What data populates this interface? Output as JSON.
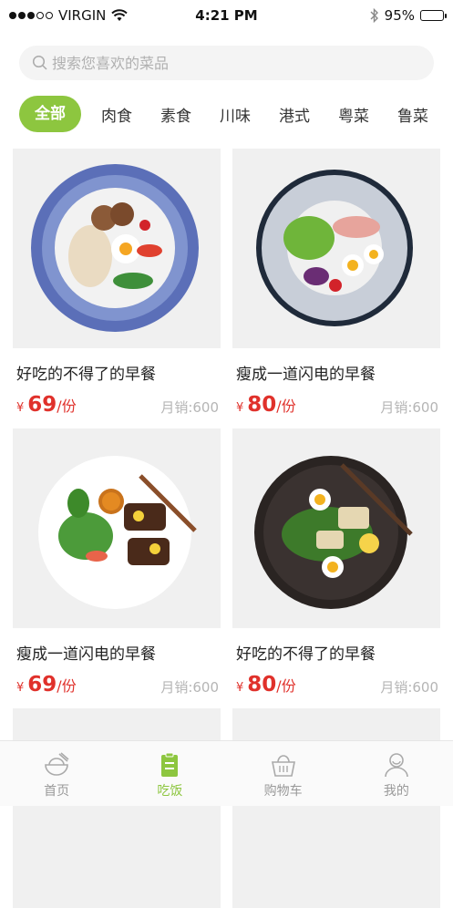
{
  "status_bar": {
    "carrier": "VIRGIN",
    "time": "4:21 PM",
    "battery": "95%",
    "battery_level": 0.95,
    "signal_bars": 3
  },
  "search": {
    "placeholder": "搜索您喜欢的菜品"
  },
  "categories": [
    {
      "label": "全部",
      "active": true
    },
    {
      "label": "肉食"
    },
    {
      "label": "素食"
    },
    {
      "label": "川味"
    },
    {
      "label": "港式"
    },
    {
      "label": "粤菜"
    },
    {
      "label": "鲁菜"
    }
  ],
  "dishes": [
    {
      "name": "好吃的不得了的早餐",
      "currency": "¥",
      "price": "69",
      "unit": "/份",
      "sales": "月销:600"
    },
    {
      "name": "瘦成一道闪电的早餐",
      "currency": "¥",
      "price": "80",
      "unit": "/份",
      "sales": "月销:600"
    },
    {
      "name": "瘦成一道闪电的早餐",
      "currency": "¥",
      "price": "69",
      "unit": "/份",
      "sales": "月销:600"
    },
    {
      "name": "好吃的不得了的早餐",
      "currency": "¥",
      "price": "80",
      "unit": "/份",
      "sales": "月销:600"
    }
  ],
  "tab_bar": [
    {
      "label": "首页",
      "icon": "rice-bowl-icon"
    },
    {
      "label": "吃饭",
      "icon": "clipboard-icon",
      "active": true
    },
    {
      "label": "购物车",
      "icon": "basket-icon"
    },
    {
      "label": "我的",
      "icon": "user-icon"
    }
  ],
  "colors": {
    "accent": "#8dc63f",
    "price": "#e0312b",
    "sales": "#b5b5b5"
  }
}
